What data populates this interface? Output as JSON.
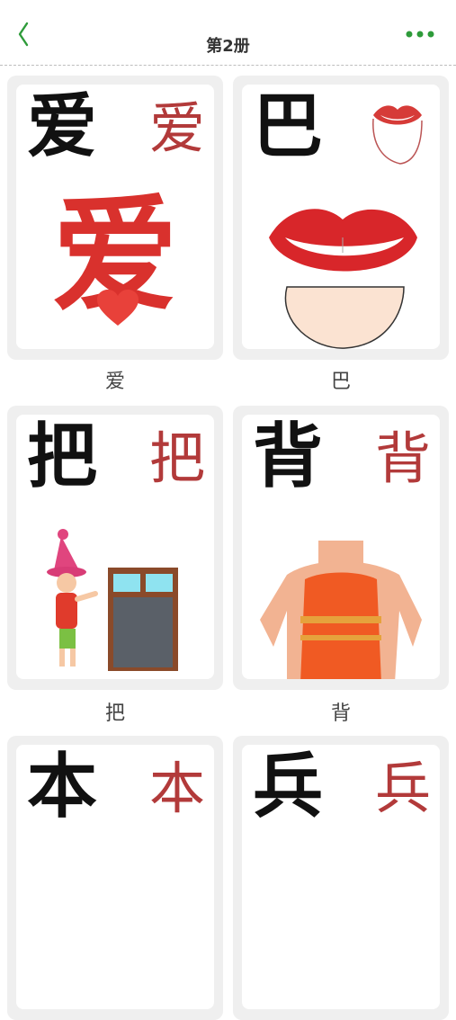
{
  "header": {
    "title": "第2册",
    "back_icon": "back-chevron-icon",
    "more_icon": "more-dots-icon",
    "accent": "#2e9b3a"
  },
  "cards": [
    {
      "char": "爱",
      "thumb": "爱",
      "illustration_char": "爱",
      "caption": "爱"
    },
    {
      "char": "巴",
      "thumb": "",
      "caption": "巴"
    },
    {
      "char": "把",
      "thumb": "把",
      "caption": "把"
    },
    {
      "char": "背",
      "thumb": "背",
      "caption": "背"
    },
    {
      "char": "本",
      "thumb": "本",
      "caption": ""
    },
    {
      "char": "兵",
      "thumb": "兵",
      "caption": ""
    }
  ]
}
